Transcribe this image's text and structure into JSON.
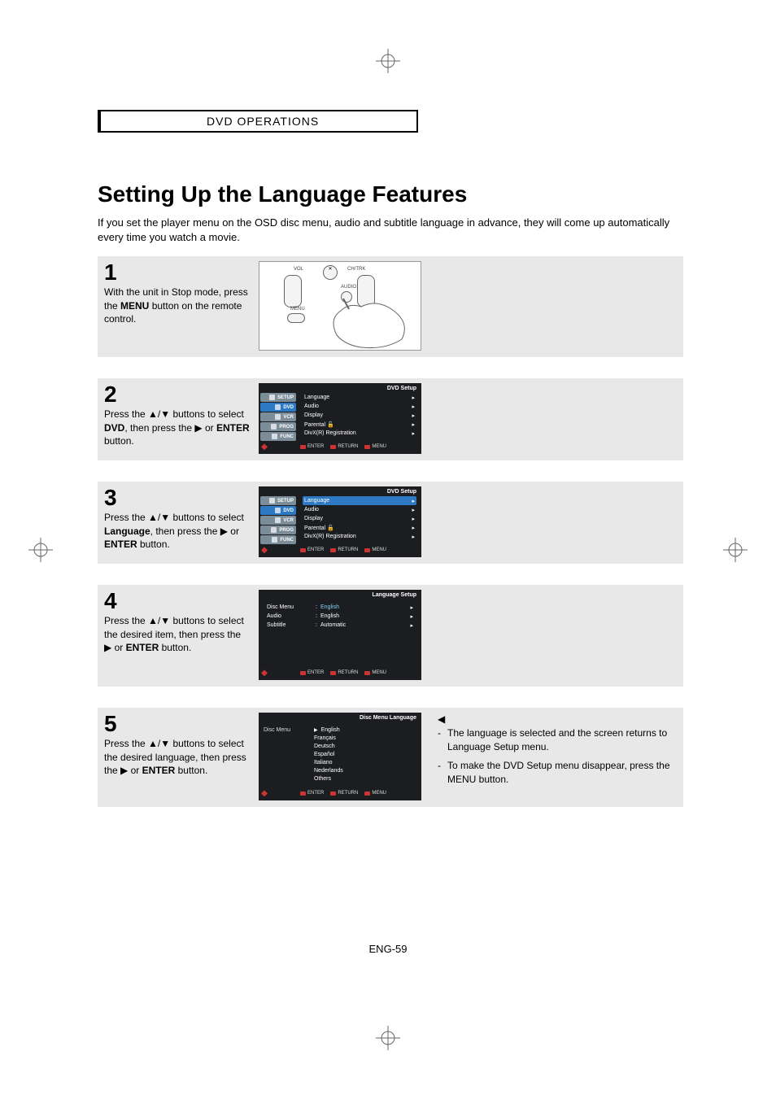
{
  "section_header": "DVD OPERATIONS",
  "title": "Setting Up the Language Features",
  "intro": "If you set the player menu on the OSD disc menu, audio and subtitle language in advance, they will come up automatically every time you watch a movie.",
  "page_number": "ENG-59",
  "steps": [
    {
      "num": "1",
      "text_pre": "With the unit in Stop mode, press the ",
      "bold1": "MENU",
      "text_post": " button on the remote control."
    },
    {
      "num": "2",
      "text_pre": "Press the ▲/▼ buttons to select ",
      "bold1": "DVD",
      "text_mid": ", then press the ▶ or ",
      "bold2": "ENTER",
      "text_post": " button."
    },
    {
      "num": "3",
      "text_pre": "Press the ▲/▼ buttons to select ",
      "bold1": "Language",
      "text_mid": ", then press the ▶ or ",
      "bold2": "ENTER",
      "text_post": " button."
    },
    {
      "num": "4",
      "text_pre": "Press the ▲/▼ buttons to select the desired item, then press the ▶ or ",
      "bold1": "ENTER",
      "text_post": " button."
    },
    {
      "num": "5",
      "text_pre": "Press the ▲/▼ buttons to select the desired language, then press the ▶ or ",
      "bold1": "ENTER",
      "text_post": " button."
    }
  ],
  "side_notes": [
    "The language is selected and the screen returns to Language Setup menu.",
    "To make the DVD Setup menu disappear, press the MENU button."
  ],
  "remote": {
    "vol": "VOL",
    "mute_icon": "mute-icon",
    "chtrk": "CH/TRK",
    "audio": "AUDIO",
    "menu": "MENU"
  },
  "osd_dvd": {
    "title": "DVD Setup",
    "tabs": [
      "SETUP",
      "DVD",
      "VCR",
      "PROG",
      "FUNC"
    ],
    "selected_tab": 1,
    "items": [
      "Language",
      "Audio",
      "Display",
      "Parental",
      "DivX(R) Registration"
    ],
    "locked_index": 3,
    "highlight_index": -1
  },
  "osd_dvd_hl": {
    "title": "DVD Setup",
    "tabs": [
      "SETUP",
      "DVD",
      "VCR",
      "PROG",
      "FUNC"
    ],
    "selected_tab": 1,
    "items": [
      "Language",
      "Audio",
      "Display",
      "Parental",
      "DivX(R) Registration"
    ],
    "locked_index": 3,
    "highlight_index": 0
  },
  "osd_lang": {
    "title": "Language Setup",
    "rows": [
      {
        "k": "Disc Menu",
        "v": "English"
      },
      {
        "k": "Audio",
        "v": "English"
      },
      {
        "k": "Subtitle",
        "v": "Automatic"
      }
    ],
    "highlight_index": 0
  },
  "osd_dml": {
    "title": "Disc Menu Language",
    "left_label": "Disc Menu",
    "options": [
      "English",
      "Français",
      "Deutsch",
      "Español",
      "Italiano",
      "Nederlands",
      "Others"
    ],
    "selected_index": 0
  },
  "osd_footer": {
    "move": "MOVE",
    "enter": "ENTER",
    "return": "RETURN",
    "menu": "MENU"
  }
}
